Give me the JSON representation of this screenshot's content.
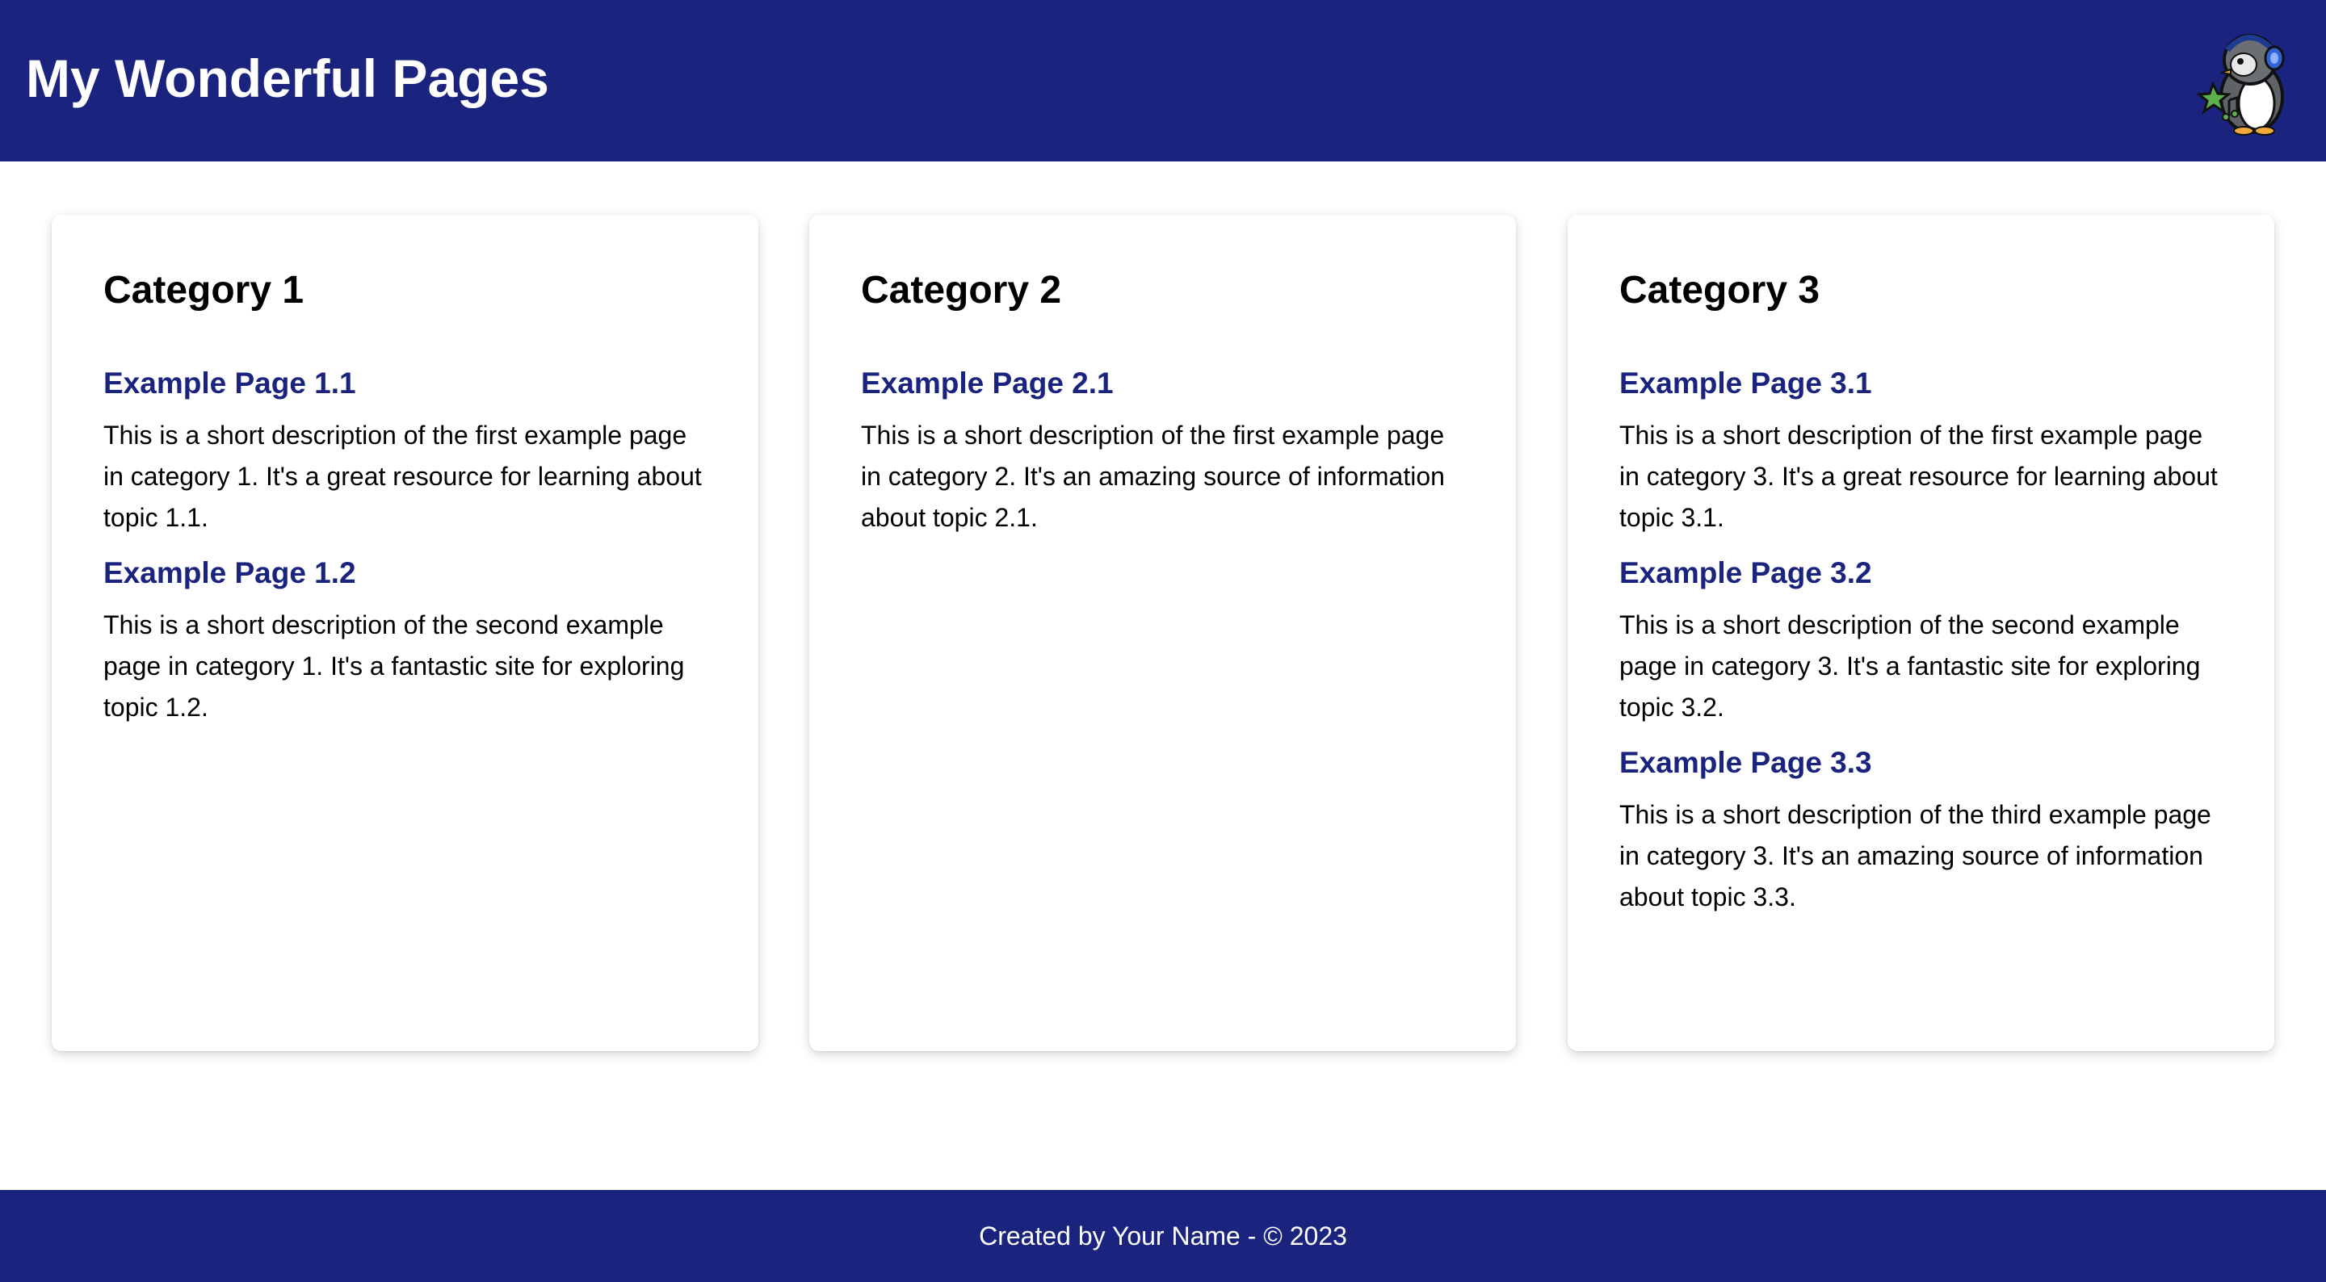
{
  "header": {
    "title": "My Wonderful Pages",
    "logo_icon": "penguin-with-headphones-logo-icon"
  },
  "colors": {
    "brand": "#1a237e",
    "link": "#1a237e",
    "background": "#ffffff"
  },
  "categories": [
    {
      "title": "Category 1",
      "pages": [
        {
          "title": "Example Page 1.1",
          "description": "This is a short description of the first example page in category 1. It's a great resource for learning about topic 1.1."
        },
        {
          "title": "Example Page 1.2",
          "description": "This is a short description of the second example page in category 1. It's a fantastic site for exploring topic 1.2."
        }
      ]
    },
    {
      "title": "Category 2",
      "pages": [
        {
          "title": "Example Page 2.1",
          "description": "This is a short description of the first example page in category 2. It's an amazing source of information about topic 2.1."
        }
      ]
    },
    {
      "title": "Category 3",
      "pages": [
        {
          "title": "Example Page 3.1",
          "description": "This is a short description of the first example page in category 3. It's a great resource for learning about topic 3.1."
        },
        {
          "title": "Example Page 3.2",
          "description": "This is a short description of the second example page in category 3. It's a fantastic site for exploring topic 3.2."
        },
        {
          "title": "Example Page 3.3",
          "description": "This is a short description of the third example page in category 3. It's an amazing source of information about topic 3.3."
        }
      ]
    }
  ],
  "footer": {
    "text": "Created by Your Name - © 2023"
  }
}
